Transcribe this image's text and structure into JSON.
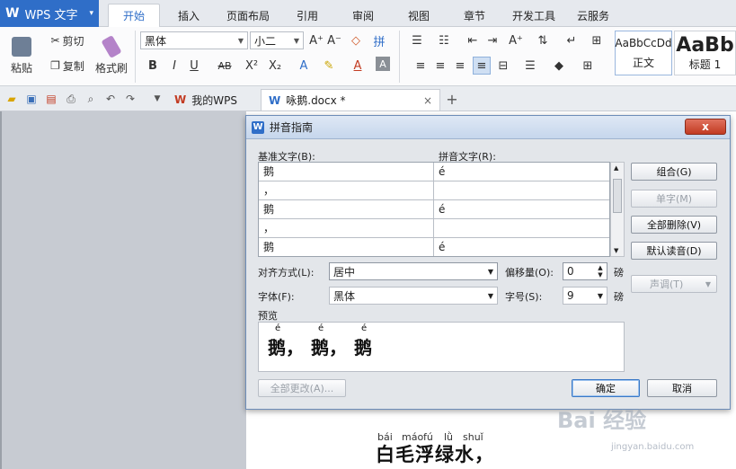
{
  "app": {
    "name": "WPS 文字",
    "caret": "▾"
  },
  "menu": [
    "开始",
    "插入",
    "页面布局",
    "引用",
    "审阅",
    "视图",
    "章节",
    "开发工具",
    "云服务"
  ],
  "ribbon": {
    "paste": "粘贴",
    "cut": "剪切",
    "copy": "复制",
    "format_painter": "格式刷",
    "font_name": "黑体",
    "font_size": "小二",
    "style_normal_sample": "AaBbCcDd",
    "style_normal": "正文",
    "style_h1_sample": "AaBb",
    "style_h1": "标题 1"
  },
  "tabs": {
    "home_tab": "我的WPS",
    "doc_tab": "咏鹅.docx *",
    "close": "×",
    "add": "+"
  },
  "dialog": {
    "title": "拼音指南",
    "close": "x",
    "base_label": "基准文字(B):",
    "pinyin_label": "拼音文字(R):",
    "rows": [
      {
        "base": "鹅",
        "pinyin": "é"
      },
      {
        "base": "，",
        "pinyin": ""
      },
      {
        "base": "鹅",
        "pinyin": "é"
      },
      {
        "base": "，",
        "pinyin": ""
      },
      {
        "base": "鹅",
        "pinyin": "é"
      }
    ],
    "align_label": "对齐方式(L):",
    "align_value": "居中",
    "offset_label": "偏移量(O):",
    "offset_value": "0",
    "offset_unit": "磅",
    "font_label": "字体(F):",
    "font_value": "黑体",
    "size_label": "字号(S):",
    "size_value": "9",
    "size_unit": "磅",
    "preview_label": "预览",
    "preview": {
      "chars": [
        "鹅，",
        "鹅，",
        "鹅"
      ],
      "ruby": [
        "é",
        "é",
        "é"
      ]
    },
    "buttons": {
      "combine": "组合(G)",
      "single": "单字(M)",
      "delete_all": "全部删除(V)",
      "default": "默认读音(D)",
      "tone": "声调(T)",
      "change_all": "全部更改(A)...",
      "ok": "确定",
      "cancel": "取消"
    }
  },
  "document": {
    "ruby": [
      "bái",
      "máo",
      "fú",
      "lǜ",
      "shuǐ"
    ],
    "line": "白毛浮绿水，"
  },
  "watermark": {
    "main": "Bai 经验",
    "sub": "jingyan.baidu.com"
  }
}
